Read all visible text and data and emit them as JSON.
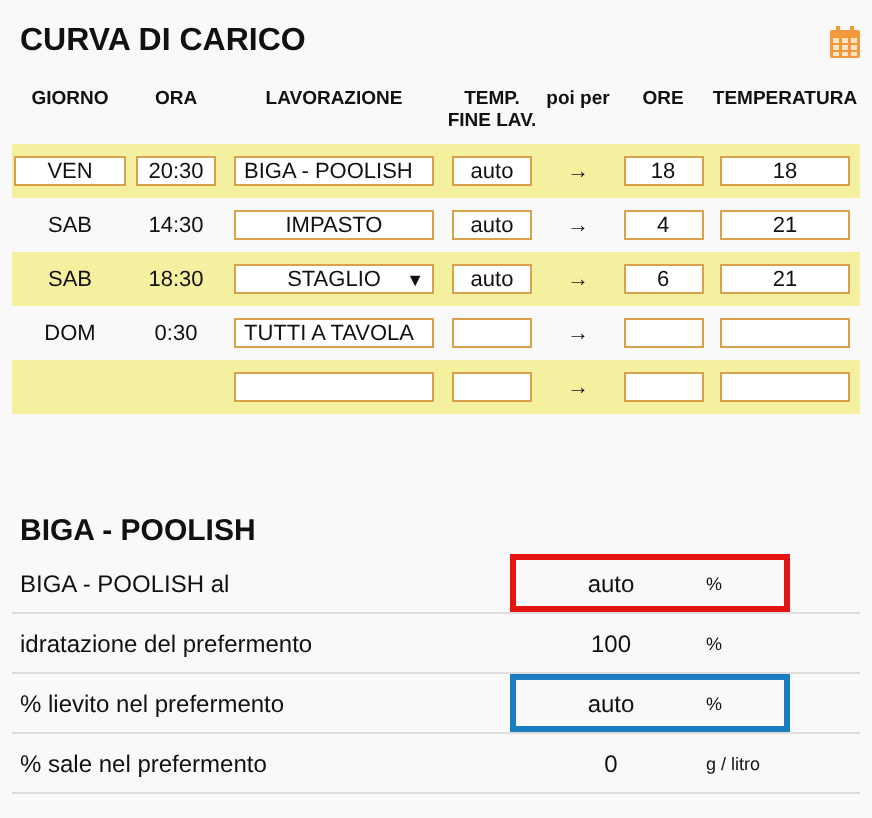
{
  "schedule": {
    "title": "CURVA DI CARICO",
    "columns": [
      "GIORNO",
      "ORA",
      "LAVORAZIONE",
      "TEMP.\nFINE LAV.",
      "poi per",
      "ORE",
      "TEMPERATURA"
    ],
    "rows": [
      {
        "day": {
          "value": "VEN",
          "kind": "field"
        },
        "time": {
          "value": "20:30",
          "kind": "field"
        },
        "activity": {
          "value": "BIGA - POOLISH",
          "kind": "input"
        },
        "end_temp": "auto",
        "arrow": "→",
        "hours": "18",
        "temperature": "18"
      },
      {
        "day": {
          "value": "SAB",
          "kind": "text"
        },
        "time": {
          "value": "14:30",
          "kind": "text"
        },
        "activity": {
          "value": "IMPASTO",
          "kind": "select"
        },
        "end_temp": "auto",
        "arrow": "→",
        "hours": "4",
        "temperature": "21"
      },
      {
        "day": {
          "value": "SAB",
          "kind": "text"
        },
        "time": {
          "value": "18:30",
          "kind": "text"
        },
        "activity": {
          "value": "STAGLIO",
          "kind": "select",
          "caret": "▼"
        },
        "end_temp": "auto",
        "arrow": "→",
        "hours": "6",
        "temperature": "21"
      },
      {
        "day": {
          "value": "DOM",
          "kind": "text"
        },
        "time": {
          "value": "0:30",
          "kind": "text"
        },
        "activity": {
          "value": "TUTTI A TAVOLA",
          "kind": "input"
        },
        "arrow": "→"
      },
      {
        "activity": {
          "kind": "input"
        },
        "arrow": "→"
      }
    ]
  },
  "preferment": {
    "title": "BIGA - POOLISH",
    "rows": [
      {
        "label": "BIGA - POOLISH al",
        "value": "auto",
        "unit": "%",
        "color": "#e41414"
      },
      {
        "label": "idratazione del prefermento",
        "value": "100",
        "unit": "%"
      },
      {
        "label": "% lievito nel prefermento",
        "value": "auto",
        "unit": "%",
        "color": "#1a7dbf"
      },
      {
        "label": "% sale nel prefermento",
        "value": "0",
        "unit": "g / litro"
      }
    ]
  }
}
